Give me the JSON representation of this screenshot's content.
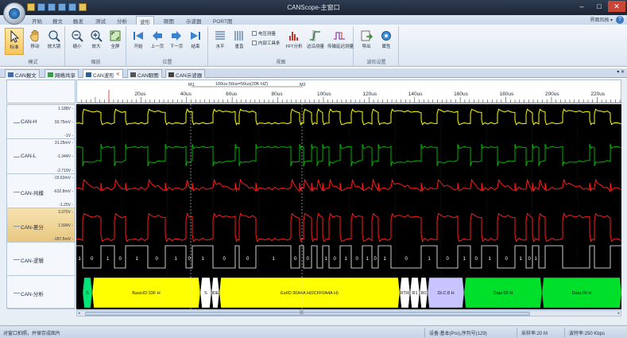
{
  "app": {
    "title": "CANScope-主窗口",
    "ribbon_tabs": [
      "开始",
      "报文",
      "触发",
      "测试",
      "分析",
      "波形",
      "眼图",
      "示波器",
      "PORT图"
    ],
    "active_ribbon_tab": "波形",
    "ribbon_right": "界面风格 ▾"
  },
  "ribbon": {
    "groups": [
      {
        "label": "模式",
        "buttons": [
          "标准",
          "移动",
          "放大镜"
        ]
      },
      {
        "label": "缩放",
        "buttons": [
          "缩小",
          "放大",
          "全屏"
        ]
      },
      {
        "label": "位置",
        "buttons": [
          "开始",
          "上一页",
          "下一页",
          "结束"
        ]
      },
      {
        "label": "视图",
        "buttons": [
          "水平",
          "垂直"
        ],
        "checks": [
          "电压测量",
          "内部工具条"
        ],
        "extra_buttons": [
          "FFT分析",
          "边沿测量",
          "传输延迟测量"
        ]
      },
      {
        "label": "波形设置",
        "buttons": [
          "导出",
          "属性"
        ]
      }
    ]
  },
  "doc_tabs": [
    "CAN报文",
    "网络共享",
    "CAN波形",
    "CAN眼图",
    "CAN示波器"
  ],
  "active_doc_tab": "CAN波形",
  "cursor_bar": {
    "m1": "M1",
    "m2": "M2",
    "delta": "100us-50us=50us(20K HZ)"
  },
  "ruler": {
    "labels": [
      "20us",
      "40us",
      "60us",
      "80us",
      "100us",
      "120us",
      "140us",
      "160us",
      "180us",
      "200us",
      "220us"
    ]
  },
  "channels": [
    {
      "name": "CAN-H",
      "top": "1.188V",
      "mid": "93.75mV",
      "bottom": "-1V"
    },
    {
      "name": "CAN-L",
      "top": "31.25mV",
      "mid": "-1.344V",
      "bottom": "-2.719V"
    },
    {
      "name": "CAN-共模",
      "top": "-15.63mV",
      "mid": "-632.8mV",
      "bottom": "-1.25V"
    },
    {
      "name": "CAN-差分",
      "top": "3.375V",
      "mid": "1.594V",
      "bottom": "-187.5mV"
    },
    {
      "name": "CAN-逻辑",
      "top": "",
      "mid": "",
      "bottom": ""
    },
    {
      "name": "CAN-分析",
      "top": "",
      "mid": "",
      "bottom": ""
    }
  ],
  "logic_bits": [
    "1",
    "0",
    "1",
    "0",
    "1",
    "0",
    "1",
    "0",
    "1",
    "0",
    "1",
    "0",
    "1",
    "0",
    "1",
    "0",
    "1",
    "0",
    "1",
    "0",
    "1",
    "0",
    "1",
    "0",
    "1",
    "0",
    "1",
    "0",
    "1",
    "0",
    "1",
    "0",
    "1",
    "0",
    "1"
  ],
  "analysis_segments": [
    {
      "label": "S",
      "color": "#00e676"
    },
    {
      "label": "BasicID:33F H",
      "color": "#ffff00"
    },
    {
      "label": "S",
      "color": "#ffffff"
    },
    {
      "label": "IDE",
      "color": "#ffffff"
    },
    {
      "label": "ExtID:30A4A H(0CFF0A4A H)",
      "color": "#ffff00"
    },
    {
      "label": "RTR",
      "color": "#ffffff"
    },
    {
      "label": "R1",
      "color": "#ffffff"
    },
    {
      "label": "R0",
      "color": "#ffffff"
    },
    {
      "label": "DLC:8 H",
      "color": "#c8c4ff"
    },
    {
      "label": "Data:05 H",
      "color": "#00e02a"
    },
    {
      "label": "Data:00 H",
      "color": "#00e02a"
    }
  ],
  "status": {
    "left": "对窗口拍照，并保存成图片",
    "device": "设备:基本(Pro),序列号(129)",
    "sample_rate": "采样率:20 M",
    "baud": "波特率:250 Kbps"
  },
  "colors": {
    "can_h": "#ffff00",
    "can_l": "#00b000",
    "common": "#ff1a1a",
    "diff": "#ff1a1a",
    "logic": "#ffffff"
  }
}
